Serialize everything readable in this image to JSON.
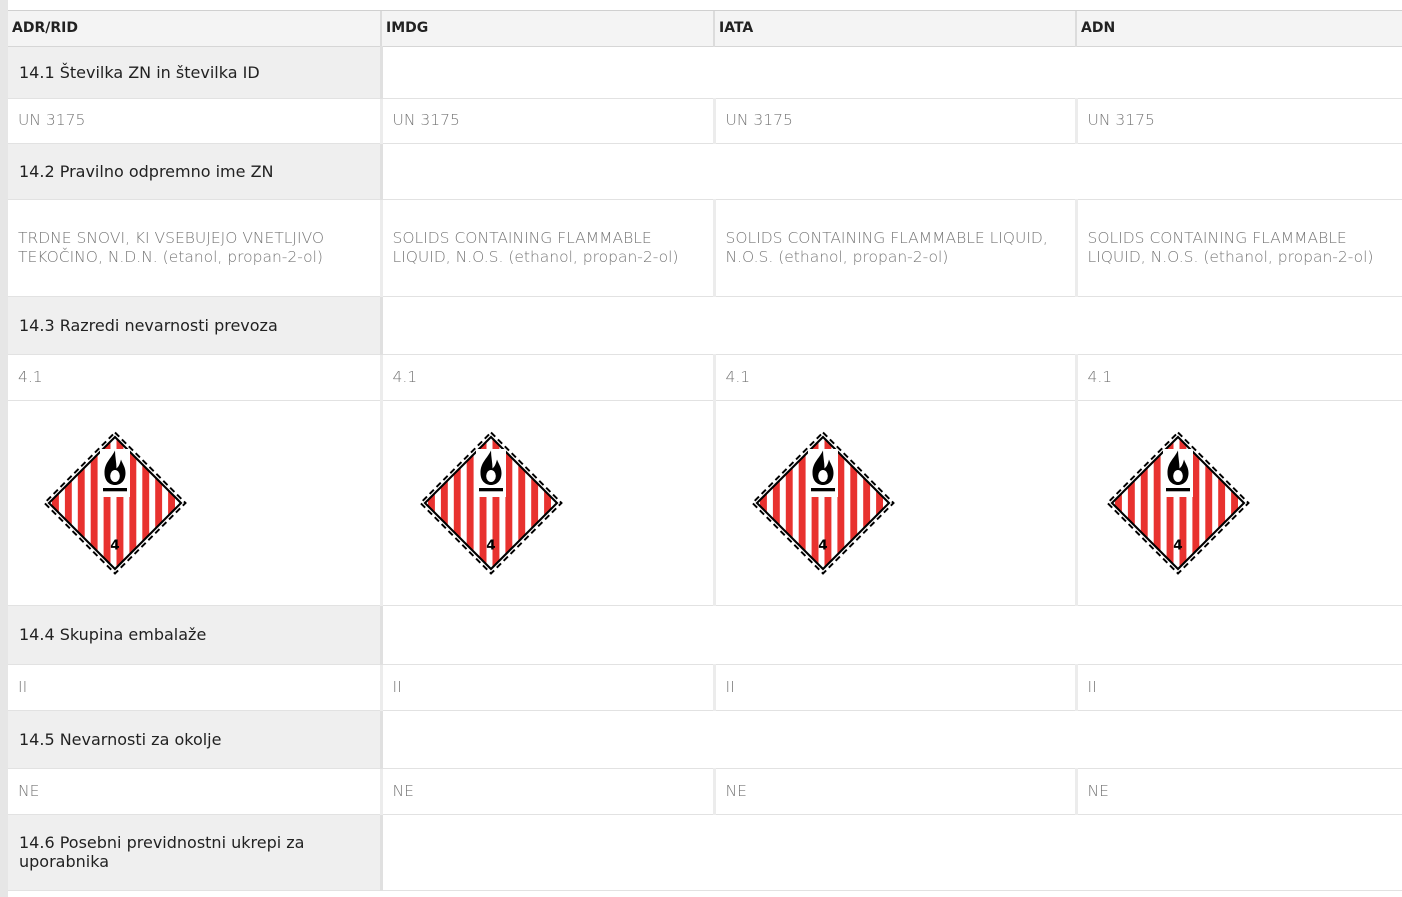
{
  "columns": [
    "ADR/RID",
    "IMDG",
    "IATA",
    "ADN"
  ],
  "sections": {
    "s1": {
      "label": "14.1 Številka ZN in številka ID",
      "values": [
        "UN 3175",
        "UN 3175",
        "UN 3175",
        "UN 3175"
      ]
    },
    "s2": {
      "label": "14.2 Pravilno odpremno ime ZN",
      "values": [
        "TRDNE SNOVI, KI VSEBUJEJO VNETLJIVO TEKOČINO, N.D.N. (etanol, propan-2-ol)",
        "SOLIDS CONTAINING FLAMMABLE LIQUID, N.O.S. (ethanol, propan-2-ol)",
        "SOLIDS CONTAINING FLAMMABLE LIQUID, N.O.S. (ethanol, propan-2-ol)",
        "SOLIDS CONTAINING FLAMMABLE LIQUID, N.O.S. (ethanol, propan-2-ol)"
      ]
    },
    "s3": {
      "label": "14.3 Razredi nevarnosti prevoza",
      "values": [
        "4.1",
        "4.1",
        "4.1",
        "4.1"
      ],
      "pictogram": {
        "icon": "flammable-solid-class-4-icon",
        "class_number": "4"
      }
    },
    "s4": {
      "label": "14.4 Skupina embalaže",
      "values": [
        "II",
        "II",
        "II",
        "II"
      ]
    },
    "s5": {
      "label": "14.5 Nevarnosti za okolje",
      "values": [
        "NE",
        "NE",
        "NE",
        "NE"
      ]
    },
    "s6": {
      "label": "14.6 Posebni previdnostni ukrepi za uporabnika"
    }
  },
  "colors": {
    "stripe_red": "#e8322f",
    "border": "#000000"
  }
}
